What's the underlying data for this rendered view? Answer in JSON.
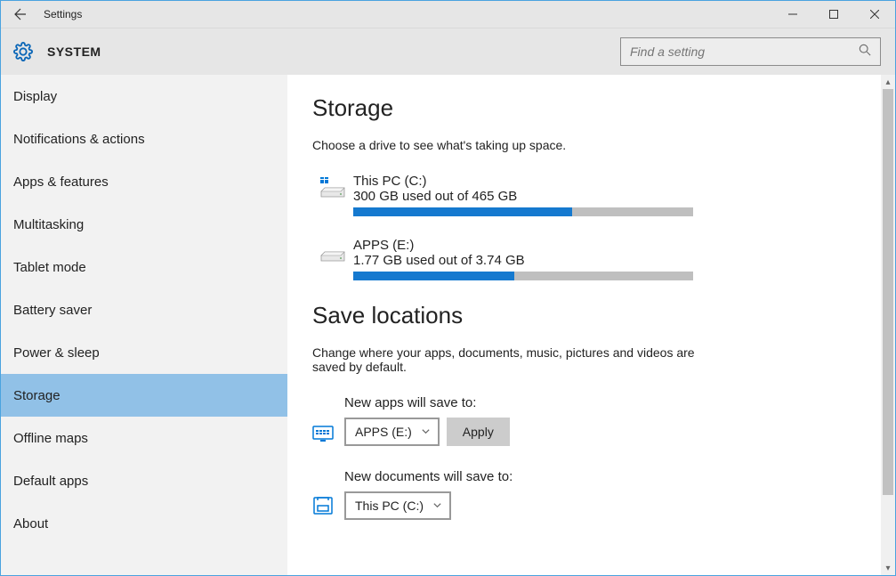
{
  "window": {
    "title": "Settings",
    "crumb": "SYSTEM"
  },
  "search": {
    "placeholder": "Find a setting"
  },
  "sidebar": {
    "items": [
      {
        "label": "Display"
      },
      {
        "label": "Notifications & actions"
      },
      {
        "label": "Apps & features"
      },
      {
        "label": "Multitasking"
      },
      {
        "label": "Tablet mode"
      },
      {
        "label": "Battery saver"
      },
      {
        "label": "Power & sleep"
      },
      {
        "label": "Storage"
      },
      {
        "label": "Offline maps"
      },
      {
        "label": "Default apps"
      },
      {
        "label": "About"
      }
    ],
    "selected_index": 7
  },
  "storage": {
    "heading": "Storage",
    "subtext": "Choose a drive to see what's taking up space.",
    "drives": [
      {
        "name": "This PC (C:)",
        "usage": "300 GB used out of 465 GB",
        "fill_pct": 64.5,
        "icon": "windows-disk"
      },
      {
        "name": "APPS (E:)",
        "usage": "1.77 GB used out of 3.74 GB",
        "fill_pct": 47.3,
        "icon": "disk"
      }
    ]
  },
  "save_locations": {
    "heading": "Save locations",
    "subtext": "Change where your apps, documents, music, pictures and videos are saved by default.",
    "rows": [
      {
        "label": "New apps will save to:",
        "value": "APPS (E:)",
        "apply": "Apply",
        "icon": "apps-icon"
      },
      {
        "label": "New documents will save to:",
        "value": "This PC (C:)",
        "apply": null,
        "icon": "documents-icon"
      }
    ]
  }
}
